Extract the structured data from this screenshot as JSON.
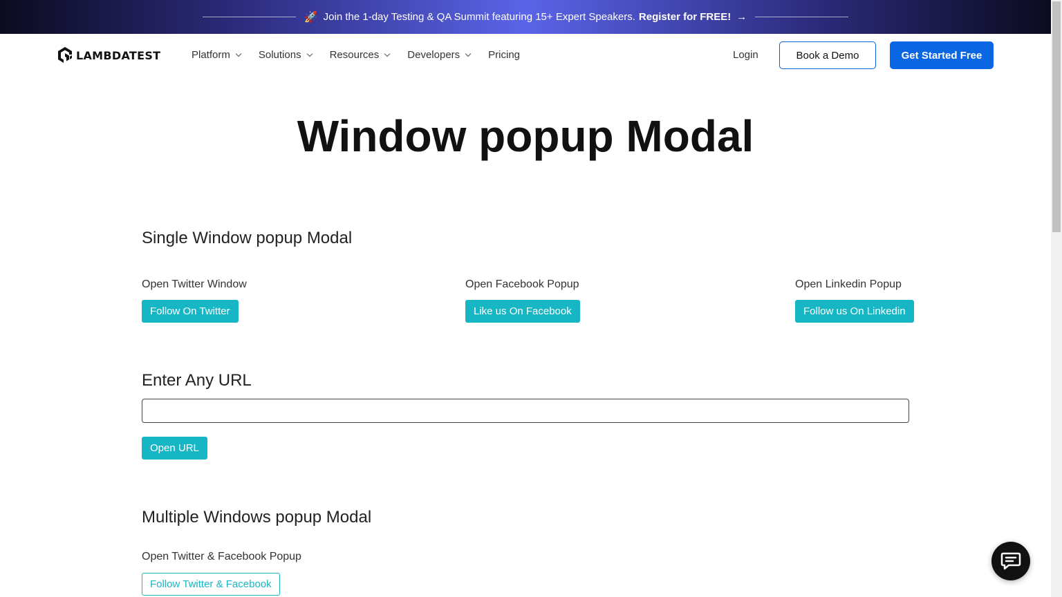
{
  "announcement": {
    "emoji": "🚀",
    "text": "Join the 1-day Testing & QA Summit featuring 15+ Expert Speakers.",
    "cta": "Register for FREE!",
    "arrow": "→"
  },
  "nav": {
    "logo_text": "LAMBDATEST",
    "items": [
      {
        "label": "Platform",
        "has_dropdown": true
      },
      {
        "label": "Solutions",
        "has_dropdown": true
      },
      {
        "label": "Resources",
        "has_dropdown": true
      },
      {
        "label": "Developers",
        "has_dropdown": true
      },
      {
        "label": "Pricing",
        "has_dropdown": false
      }
    ],
    "login": "Login",
    "demo": "Book a Demo",
    "start": "Get Started Free"
  },
  "page": {
    "title": "Window popup Modal",
    "single": {
      "heading": "Single Window popup Modal",
      "twitter_label": "Open Twitter Window",
      "twitter_button": "Follow On Twitter",
      "facebook_label": "Open Facebook Popup",
      "facebook_button": "Like us On Facebook",
      "linkedin_label": "Open Linkedin Popup",
      "linkedin_button": "Follow us On Linkedin"
    },
    "url": {
      "heading": "Enter Any URL",
      "value": "",
      "button": "Open URL"
    },
    "multiple": {
      "heading": "Multiple Windows popup Modal",
      "label": "Open Twitter & Facebook Popup",
      "button": "Follow Twitter & Facebook"
    }
  },
  "colors": {
    "accent_teal": "#17b6c4",
    "primary_blue": "#0b66e4"
  }
}
